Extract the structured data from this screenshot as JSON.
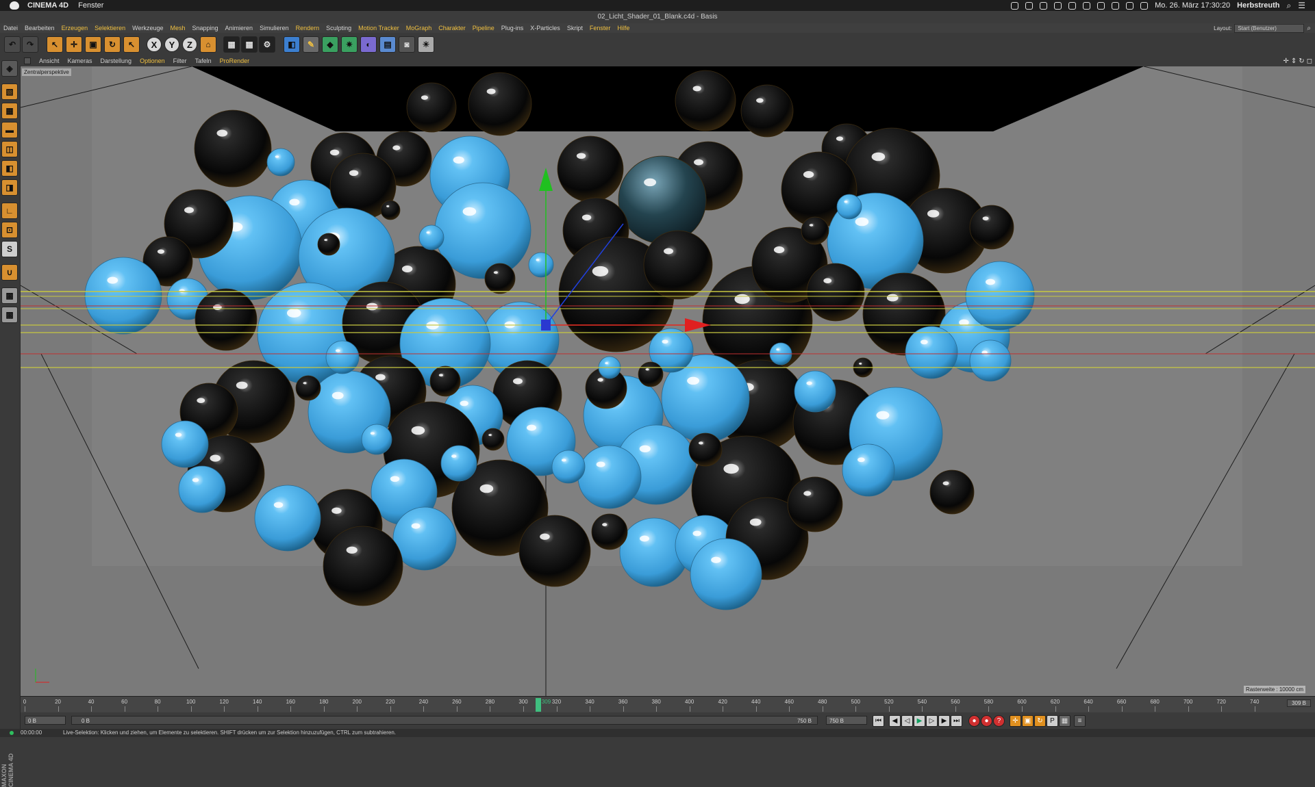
{
  "macbar": {
    "app_name": "CINEMA 4D",
    "menu": "Fenster",
    "datetime": "Mo. 26. März  17:30:20",
    "user": "Herbstreuth"
  },
  "window": {
    "title": "02_Licht_Shader_01_Blank.c4d - Basis"
  },
  "mainmenu": {
    "items": [
      {
        "label": "Datei",
        "hl": false
      },
      {
        "label": "Bearbeiten",
        "hl": false
      },
      {
        "label": "Erzeugen",
        "hl": true
      },
      {
        "label": "Selektieren",
        "hl": true
      },
      {
        "label": "Werkzeuge",
        "hl": false
      },
      {
        "label": "Mesh",
        "hl": true
      },
      {
        "label": "Snapping",
        "hl": false
      },
      {
        "label": "Animieren",
        "hl": false
      },
      {
        "label": "Simulieren",
        "hl": false
      },
      {
        "label": "Rendern",
        "hl": true
      },
      {
        "label": "Sculpting",
        "hl": false
      },
      {
        "label": "Motion Tracker",
        "hl": true
      },
      {
        "label": "MoGraph",
        "hl": true
      },
      {
        "label": "Charakter",
        "hl": true
      },
      {
        "label": "Pipeline",
        "hl": true
      },
      {
        "label": "Plug-ins",
        "hl": false
      },
      {
        "label": "X-Particles",
        "hl": false
      },
      {
        "label": "Skript",
        "hl": false
      },
      {
        "label": "Fenster",
        "hl": true
      },
      {
        "label": "Hilfe",
        "hl": true
      }
    ],
    "layout_label": "Layout:",
    "layout_value": "Start (Benutzer)"
  },
  "toolbar": {
    "axis_x": "X",
    "axis_y": "Y",
    "axis_z": "Z"
  },
  "vpmenu": {
    "items": [
      {
        "label": "Ansicht",
        "hl": false
      },
      {
        "label": "Kameras",
        "hl": false
      },
      {
        "label": "Darstellung",
        "hl": false
      },
      {
        "label": "Optionen",
        "hl": true
      },
      {
        "label": "Filter",
        "hl": false
      },
      {
        "label": "Tafeln",
        "hl": false
      },
      {
        "label": "ProRender",
        "hl": true
      }
    ]
  },
  "viewport": {
    "camera_label": "Zentralperspektive",
    "raster": "Rasterweite : 10000 cm",
    "colors": {
      "blue_sphere": "#4aaee8",
      "black_sphere": "#0c0c0c",
      "bg": "#7a7a7a"
    }
  },
  "timeline": {
    "ticks": [
      "0",
      "20",
      "40",
      "60",
      "80",
      "100",
      "120",
      "140",
      "160",
      "180",
      "200",
      "220",
      "240",
      "260",
      "280",
      "300",
      "320",
      "340",
      "360",
      "380",
      "400",
      "420",
      "440",
      "460",
      "480",
      "500",
      "520",
      "540",
      "560",
      "580",
      "600",
      "620",
      "640",
      "660",
      "680",
      "700",
      "720",
      "740"
    ],
    "current": "309",
    "end_field": "309 B"
  },
  "transport": {
    "start_field": "0 B",
    "range_start": "0 B",
    "range_end": "750 B",
    "max_field": "750 B"
  },
  "brand": "MAXON CINEMA 4D",
  "status": {
    "time": "00:00:00",
    "message": "Live-Selektion: Klicken und ziehen, um Elemente zu selektieren. SHIFT drücken um zur Selektion hinzuzufügen, CTRL zum subtrahieren."
  }
}
